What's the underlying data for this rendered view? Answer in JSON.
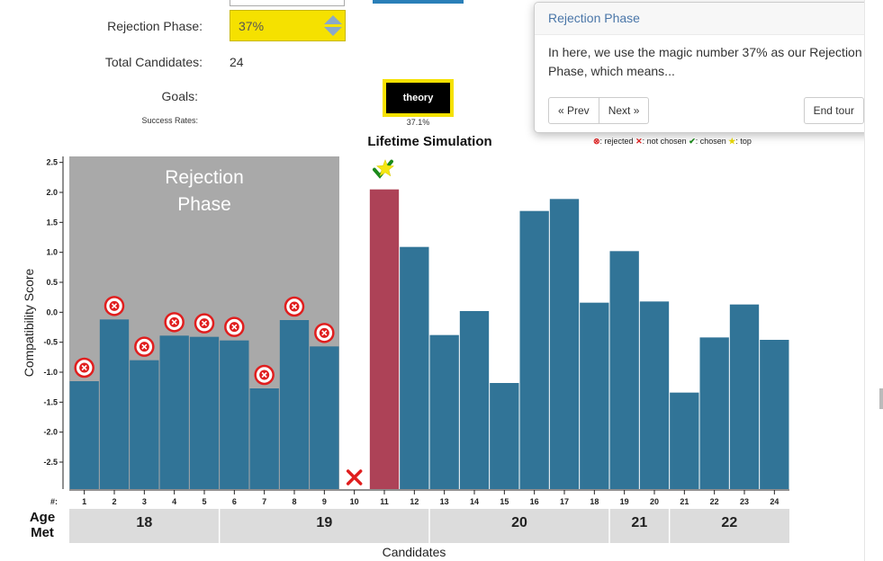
{
  "form": {
    "rejection_label": "Rejection Phase:",
    "rejection_value": "37%",
    "candidates_label": "Total Candidates:",
    "candidates_value": "24",
    "goals_label": "Goals:",
    "goal_button": "theory",
    "success_label": "Success Rates:",
    "success_value": "37.1%"
  },
  "popover": {
    "title": "Rejection Phase",
    "body": "In here, we use the magic number 37% as our Rejection Phase, which means...",
    "prev": "« Prev",
    "next": "Next »",
    "end": "End tour"
  },
  "legend": {
    "rejected": ": rejected",
    "not_chosen": ": not chosen",
    "chosen": ": chosen",
    "top": ": top"
  },
  "colors": {
    "bar": "#317497",
    "chosen_bar": "#ad4257",
    "rejection_bg": "#a9a9a9",
    "rejected_marker": "#e01e1e",
    "chosen_check": "#1b8a1b",
    "star": "#f5e613",
    "age_band": "#dcdcdc",
    "highlight": "#f5e100"
  },
  "chart_data": {
    "type": "bar",
    "title": "Lifetime Simulation",
    "xlabel": "Candidates",
    "ylabel": "Compatibility Score",
    "ylim": [
      -2.95,
      2.6
    ],
    "yticks": [
      "2.5",
      "2.0",
      "1.5",
      "1.0",
      "0.5",
      "0.0",
      "-0.5",
      "-1.0",
      "-1.5",
      "-2.0",
      "-2.5"
    ],
    "ytick_values": [
      2.5,
      2.0,
      1.5,
      1.0,
      0.5,
      0.0,
      -0.5,
      -1.0,
      -1.5,
      -2.0,
      -2.5
    ],
    "x_prefix": "#:",
    "categories": [
      "1",
      "2",
      "3",
      "4",
      "5",
      "6",
      "7",
      "8",
      "9",
      "10",
      "11",
      "12",
      "13",
      "14",
      "15",
      "16",
      "17",
      "18",
      "19",
      "20",
      "21",
      "22",
      "23",
      "24"
    ],
    "values": [
      -1.15,
      -0.12,
      -0.8,
      -0.39,
      -0.41,
      -0.47,
      -1.27,
      -0.13,
      -0.57,
      null,
      2.05,
      1.09,
      -0.38,
      0.02,
      -1.18,
      1.69,
      1.89,
      0.16,
      1.02,
      0.18,
      -1.34,
      -0.42,
      0.13,
      -0.46
    ],
    "status": [
      "rejected",
      "rejected",
      "rejected",
      "rejected",
      "rejected",
      "rejected",
      "rejected",
      "rejected",
      "rejected",
      "not_chosen",
      "chosen",
      "",
      "",
      "",
      "",
      "",
      "",
      "",
      "",
      "",
      "",
      "",
      "",
      ""
    ],
    "top_candidate": 11,
    "rejection_phase_label": [
      "Rejection",
      "Phase"
    ],
    "rejection_count": 9,
    "age_label": [
      "Age",
      "Met"
    ],
    "age_groups": [
      {
        "age": "18",
        "from": 1,
        "to": 5
      },
      {
        "age": "19",
        "from": 6,
        "to": 12
      },
      {
        "age": "20",
        "from": 13,
        "to": 18
      },
      {
        "age": "21",
        "from": 19,
        "to": 20
      },
      {
        "age": "22",
        "from": 21,
        "to": 24
      }
    ]
  }
}
